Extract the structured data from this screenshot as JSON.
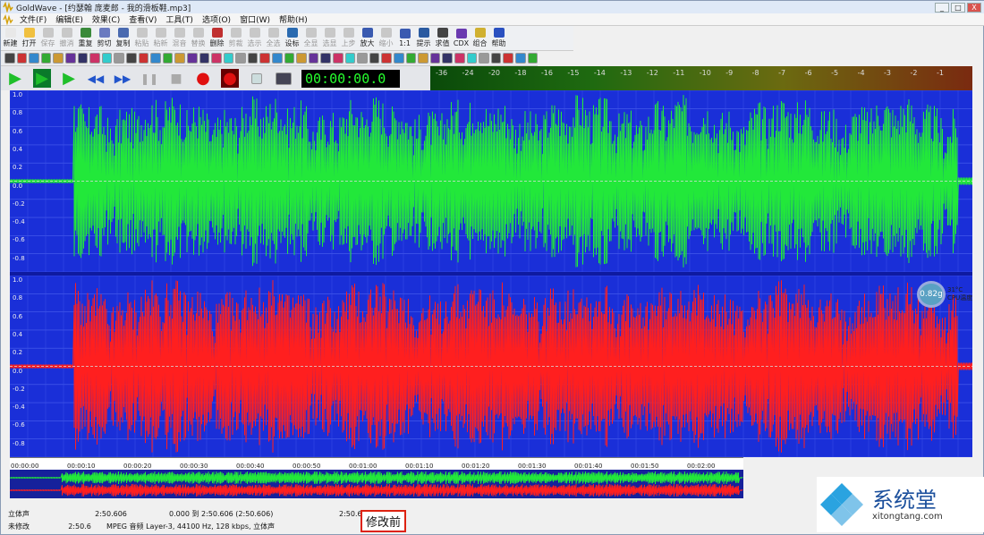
{
  "window": {
    "title": "GoldWave - [约瑟翰 庞麦郎 - 我的滑板鞋.mp3]",
    "min": "_",
    "max": "□",
    "close": "X"
  },
  "menu": [
    "文件(F)",
    "编辑(E)",
    "效果(C)",
    "查看(V)",
    "工具(T)",
    "选项(O)",
    "窗口(W)",
    "帮助(H)"
  ],
  "toolbar": [
    {
      "label": "新建",
      "color": "#e8e8e8",
      "enabled": true
    },
    {
      "label": "打开",
      "color": "#f0c040",
      "enabled": true
    },
    {
      "label": "保存",
      "color": "#c8c8c8",
      "enabled": false
    },
    {
      "label": "撤消",
      "color": "#c8c8c8",
      "enabled": false
    },
    {
      "label": "重复",
      "color": "#3a8a3a",
      "enabled": true
    },
    {
      "label": "剪切",
      "color": "#6a7ac0",
      "enabled": true
    },
    {
      "label": "复制",
      "color": "#4a6ab0",
      "enabled": true
    },
    {
      "label": "粘贴",
      "color": "#c8c8c8",
      "enabled": false
    },
    {
      "label": "粘新",
      "color": "#c8c8c8",
      "enabled": false
    },
    {
      "label": "混音",
      "color": "#c8c8c8",
      "enabled": false
    },
    {
      "label": "替换",
      "color": "#c8c8c8",
      "enabled": false
    },
    {
      "label": "删除",
      "color": "#c03030",
      "enabled": true
    },
    {
      "label": "剪裁",
      "color": "#c8c8c8",
      "enabled": false
    },
    {
      "label": "选示",
      "color": "#c8c8c8",
      "enabled": false
    },
    {
      "label": "全选",
      "color": "#c8c8c8",
      "enabled": false
    },
    {
      "label": "设标",
      "color": "#2a6ab0",
      "enabled": true
    },
    {
      "label": "全显",
      "color": "#c8c8c8",
      "enabled": false
    },
    {
      "label": "选显",
      "color": "#c8c8c8",
      "enabled": false
    },
    {
      "label": "上步",
      "color": "#c8c8c8",
      "enabled": false
    },
    {
      "label": "放大",
      "color": "#3a5ab0",
      "enabled": true
    },
    {
      "label": "缩小",
      "color": "#c8c8c8",
      "enabled": false
    },
    {
      "label": "1:1",
      "color": "#3a5ab0",
      "enabled": true
    },
    {
      "label": "提示",
      "color": "#2a5aa0",
      "enabled": true
    },
    {
      "label": "求值",
      "color": "#444444",
      "enabled": true
    },
    {
      "label": "CDX",
      "color": "#6a3ab0",
      "enabled": true
    },
    {
      "label": "组合",
      "color": "#d0b030",
      "enabled": true
    },
    {
      "label": "帮助",
      "color": "#2a50c0",
      "enabled": true
    }
  ],
  "transport": {
    "time": "00:00:00.0",
    "play": "▶",
    "play_sel": "▶",
    "play_cur": "▶",
    "rewind": "◀◀",
    "forward": "▶▶",
    "pause": "❚❚",
    "stop": "■",
    "record": "●",
    "record2": "●"
  },
  "meter": {
    "ticks": [
      "-36",
      "-24",
      "-20",
      "-18",
      "-16",
      "-15",
      "-14",
      "-13",
      "-12",
      "-11",
      "-10",
      "-9",
      "-8",
      "-7",
      "-6",
      "-5",
      "-4",
      "-3",
      "-2",
      "-1"
    ]
  },
  "wave": {
    "top_labels": [
      "1.0",
      "0.8",
      "0.6",
      "0.4",
      "0.2",
      "0.0",
      "-0.2",
      "-0.4",
      "-0.6",
      "-0.8"
    ],
    "bottom_labels": [
      "1.0",
      "0.8",
      "0.6",
      "0.4",
      "0.2",
      "0.0",
      "-0.2",
      "-0.4",
      "-0.6",
      "-0.8"
    ],
    "left_color": "#22e83a",
    "right_color": "#ff1f1f",
    "bg": "#1a2fd8"
  },
  "timeline": [
    "00:00:00",
    "00:00:10",
    "00:00:20",
    "00:00:30",
    "00:00:40",
    "00:00:50",
    "00:01:00",
    "00:01:10",
    "00:01:20",
    "00:01:30",
    "00:01:40",
    "00:01:50",
    "00:02:00"
  ],
  "status": {
    "channel": "立体声",
    "length": "2:50.606",
    "range": "0.000 到 2:50.606 (2:50.606)",
    "right_len": "2:50.606",
    "modified": "未修改",
    "dur": "2:50.6",
    "format": "MPEG 音频 Layer-3, 44100 Hz, 128 kbps, 立体声"
  },
  "annotation": "修改前",
  "cpu": {
    "load": "0.82g",
    "temp": "31°C",
    "label": "CPU温度"
  },
  "watermark": {
    "name": "系统堂",
    "url": "xitongtang.com"
  }
}
